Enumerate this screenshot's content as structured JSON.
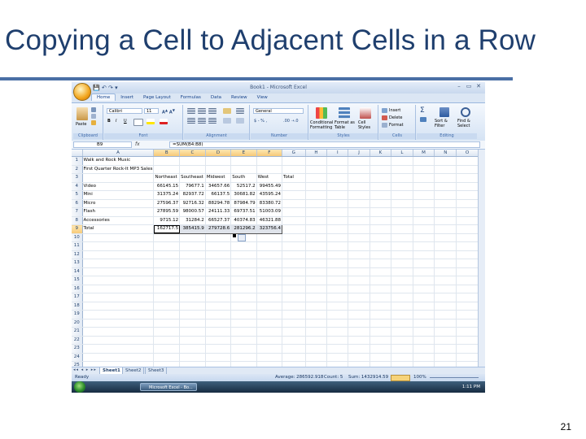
{
  "slide": {
    "title": "Copying a Cell to Adjacent Cells in a Row",
    "page_number": "21"
  },
  "window": {
    "title": "Book1 - Microsoft Excel",
    "qat": "💾 ↶ ↷ ▾",
    "controls": [
      "–",
      "▭",
      "✕"
    ]
  },
  "ribbon": {
    "tabs": [
      "Home",
      "Insert",
      "Page Layout",
      "Formulas",
      "Data",
      "Review",
      "View"
    ],
    "groups": {
      "clipboard": {
        "label": "Clipboard",
        "paste": "Paste"
      },
      "font": {
        "label": "Font",
        "font_name": "Calibri",
        "font_size": "11",
        "bold": "B",
        "italic": "I",
        "underline": "U"
      },
      "alignment": {
        "label": "Alignment"
      },
      "number": {
        "label": "Number",
        "format": "General",
        "currency": "$ - % ,",
        "decimals": ".00 ⇢.0"
      },
      "styles": {
        "label": "Styles",
        "conditional": "Conditional Formatting",
        "format_table": "Format as Table",
        "cell_styles": "Cell Styles"
      },
      "cells": {
        "label": "Cells",
        "insert": "Insert",
        "delete": "Delete",
        "format": "Format"
      },
      "editing": {
        "label": "Editing",
        "sum": "Σ",
        "sort": "Sort & Filter",
        "find": "Find & Select"
      }
    }
  },
  "formula_bar": {
    "name_box": "B9",
    "fx": "fx",
    "formula": "=SUM(B4:B8)"
  },
  "sheet": {
    "columns": [
      "A",
      "B",
      "C",
      "D",
      "E",
      "F",
      "G",
      "H",
      "I",
      "J",
      "K",
      "L",
      "M",
      "N",
      "O"
    ],
    "rows": [
      [
        "Walk and Rock Music",
        "",
        "",
        "",
        "",
        "",
        ""
      ],
      [
        "First Quarter Rock-It MP3 Sales",
        "",
        "",
        "",
        "",
        "",
        ""
      ],
      [
        "",
        "Northeast",
        "Southeast",
        "Midwest",
        "South",
        "West",
        "Total"
      ],
      [
        "Video",
        "66145.15",
        "79677.1",
        "34657.66",
        "52517.2",
        "99455.49",
        ""
      ],
      [
        "Mini",
        "31375.24",
        "82937.72",
        "66137.5",
        "30681.82",
        "43595.24",
        ""
      ],
      [
        "Micro",
        "27596.37",
        "92716.32",
        "88294.78",
        "87984.79",
        "83380.72",
        ""
      ],
      [
        "Flash",
        "27895.59",
        "98000.57",
        "24111.33",
        "69737.51",
        "51003.09",
        ""
      ],
      [
        "Accessories",
        "9715.12",
        "31284.2",
        "66527.37",
        "40374.83",
        "46321.88",
        ""
      ],
      [
        "Total",
        "162717.5",
        "385415.9",
        "279728.6",
        "281296.2",
        "323756.4",
        ""
      ]
    ],
    "row_count": 26,
    "sheet_tabs": [
      "Sheet1",
      "Sheet2",
      "Sheet3"
    ],
    "sheet_nav": "◂◂ ◂ ▸ ▸▸"
  },
  "status_bar": {
    "ready": "Ready",
    "average": "Average: 286592.918",
    "count": "Count: 5",
    "sum": "Sum: 1432914.59",
    "zoom": "100%"
  },
  "taskbar": {
    "item": "Microsoft Excel - Bo...",
    "clock": "1:11 PM"
  }
}
